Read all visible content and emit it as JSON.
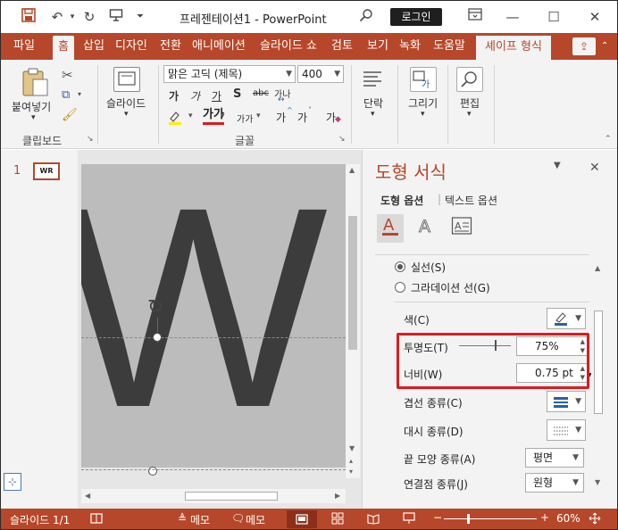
{
  "titlebar": {
    "title": "프레젠테이션1  -  PowerPoint",
    "login_label": "로그인",
    "icons": [
      "save-icon",
      "undo-icon",
      "redo-icon",
      "present-icon",
      "customize-icon",
      "search-icon",
      "minimize-icon",
      "maximize-icon",
      "close-icon"
    ]
  },
  "tabs": [
    "파일",
    "홈",
    "삽입",
    "디자인",
    "전환",
    "애니메이션",
    "슬라이드 쇼",
    "검토",
    "보기",
    "녹화",
    "도움말",
    "셰이프 형식"
  ],
  "ribbon": {
    "paste_label": "붙여넣기",
    "clipboard_group": "클립보드",
    "slide_label": "슬라이드",
    "font_name": "맑은 고딕 (제목)",
    "font_size": "400",
    "font_group": "글꼴",
    "paragraph_label": "단락",
    "drawing_label": "그리기",
    "edit_label": "편집",
    "font_buttons": {
      "grow": "가",
      "shrink": "가",
      "clear": "가",
      "shadow": "S",
      "strike": "abc",
      "spacing": "가나",
      "case": "가가",
      "super": "가",
      "sub": "가",
      "highlight": "가"
    }
  },
  "slide_panel": {
    "slide_number": "1",
    "thumb_text": "WR"
  },
  "slide": {
    "text": "WR"
  },
  "format_pane": {
    "title": "도형 서식",
    "tab_shape_options": "도형 옵션",
    "tab_text_options": "텍스트 옵션",
    "radio_solid": "실선(S)",
    "radio_gradient": "그라데이션 선(G)",
    "color_label": "색(C)",
    "transparency_label": "투명도(T)",
    "transparency_value": "75%",
    "width_label": "너비(W)",
    "width_value": "0.75 pt",
    "compound_label": "겹선 종류(C)",
    "dash_label": "대시 종류(D)",
    "cap_label": "끝 모양 종류(A)",
    "cap_value": "평면",
    "join_label": "연결점 종류(J)",
    "join_value": "원형",
    "transparency_fraction": 0.75,
    "line_color": "#2b5fa8"
  },
  "statusbar": {
    "slide_count": "슬라이드 1/1",
    "notes1": "메모",
    "notes2": "메모",
    "zoom": "60%"
  },
  "colors": {
    "accent": "#b7472a",
    "highlight_box": "#e0191f"
  }
}
